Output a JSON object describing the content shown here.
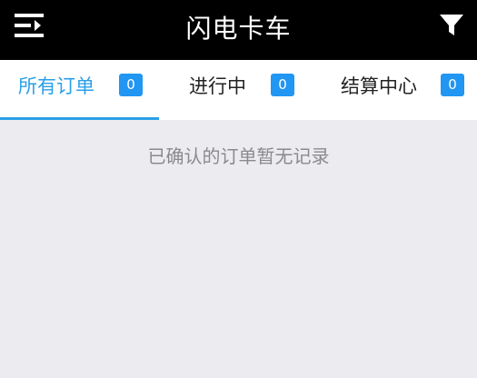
{
  "header": {
    "title": "闪电卡车",
    "menu_icon": "menu-icon",
    "filter_icon": "filter-icon"
  },
  "tabs": [
    {
      "label": "所有订单",
      "count": "0",
      "active": true
    },
    {
      "label": "进行中",
      "count": "0",
      "active": false
    },
    {
      "label": "结算中心",
      "count": "0",
      "active": false
    }
  ],
  "content": {
    "empty_message": "已确认的订单暂无记录"
  },
  "colors": {
    "header_bg": "#000000",
    "accent": "#2a9fe8",
    "badge_bg": "#2196f3",
    "page_bg": "#ebebf0"
  }
}
